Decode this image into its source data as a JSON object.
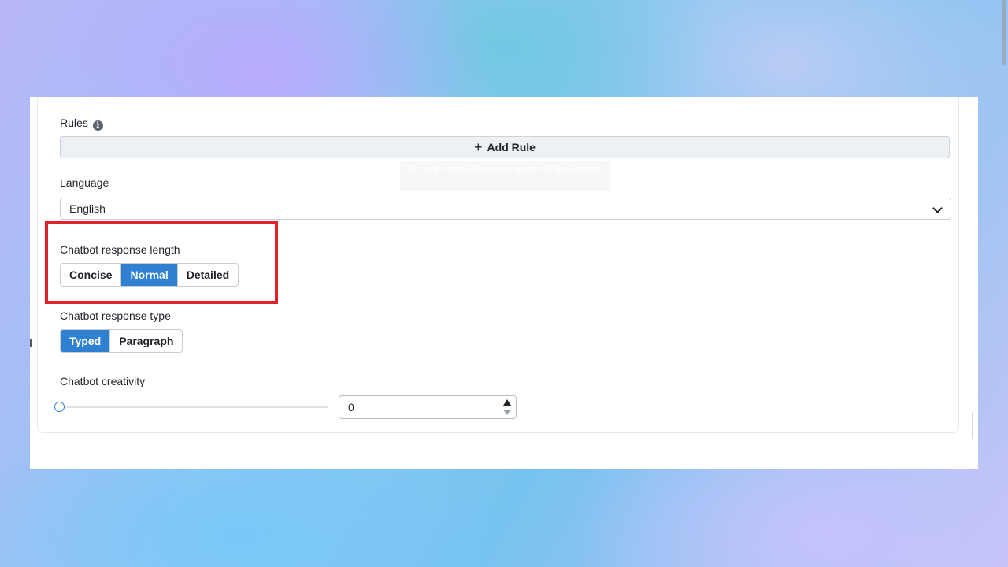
{
  "rules": {
    "label": "Rules",
    "info_icon": "i",
    "add_rule_label": "Add Rule",
    "add_rule_icon": "+"
  },
  "tooltip": {
    "text": "This is the default language spoken by the chatbot"
  },
  "language": {
    "label": "Language",
    "selected": "English"
  },
  "response_length": {
    "label": "Chatbot response length",
    "options": [
      "Concise",
      "Normal",
      "Detailed"
    ],
    "selected": "Normal"
  },
  "response_type": {
    "label": "Chatbot response type",
    "options": [
      "Typed",
      "Paragraph"
    ],
    "selected": "Typed"
  },
  "creativity": {
    "label": "Chatbot creativity",
    "value": "0",
    "slider_fraction": 0
  },
  "colors": {
    "accent": "#2f80d1",
    "highlight": "#e1222b"
  }
}
